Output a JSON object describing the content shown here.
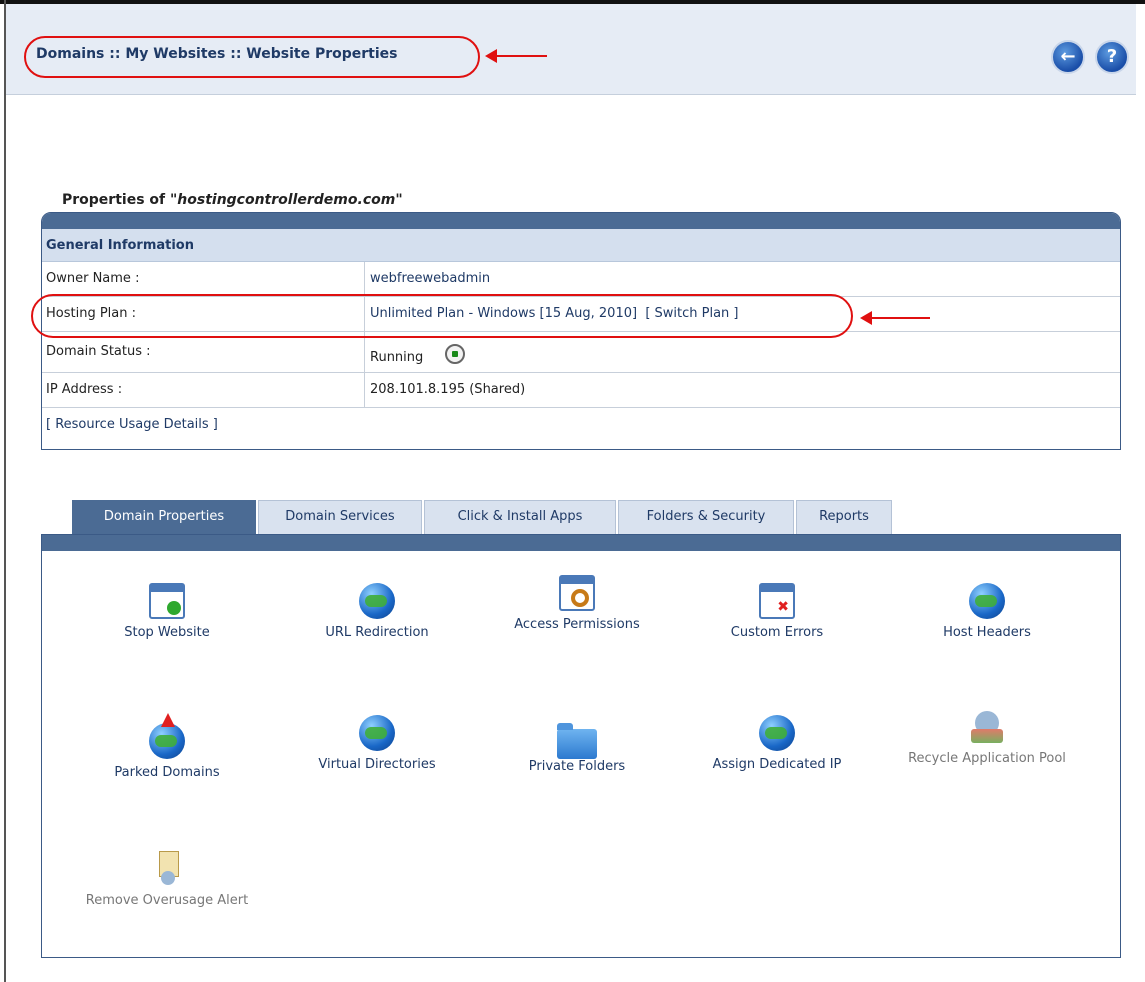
{
  "header": {
    "breadcrumb": "Domains :: My Websites :: Website Properties",
    "back_icon": "arrow-left-circle-icon",
    "help_icon": "question-circle-icon"
  },
  "properties": {
    "title_prefix": "Properties of ",
    "domain": "\"hostingcontrollerdemo.com\"",
    "section_label": "General Information",
    "rows": [
      {
        "label": "Owner Name :",
        "value": "webfreewebadmin"
      },
      {
        "label": "Hosting Plan :",
        "value": "Unlimited Plan - Windows [15 Aug, 2010]",
        "action": "[ Switch Plan ]"
      },
      {
        "label": "Domain Status :",
        "value": "Running"
      },
      {
        "label": "IP Address :",
        "value": "208.101.8.195 (Shared)"
      }
    ],
    "resource_link": "[ Resource Usage Details ]"
  },
  "tabs": [
    {
      "label": "Domain Properties",
      "active": true
    },
    {
      "label": "Domain Services"
    },
    {
      "label": "Click & Install Apps"
    },
    {
      "label": "Folders & Security"
    },
    {
      "label": "Reports"
    }
  ],
  "tools": [
    {
      "label": "Stop Website",
      "icon": "window-stop-icon"
    },
    {
      "label": "URL Redirection",
      "icon": "globe-redirect-icon"
    },
    {
      "label": "Access Permissions",
      "icon": "keys-icon"
    },
    {
      "label": "Custom Errors",
      "icon": "window-error-icon"
    },
    {
      "label": "Host Headers",
      "icon": "globe-window-icon"
    },
    {
      "label": "Parked Domains",
      "icon": "globe-arrow-icon"
    },
    {
      "label": "Virtual Directories",
      "icon": "globe-folder-icon"
    },
    {
      "label": "Private Folders",
      "icon": "folder-icon"
    },
    {
      "label": "Assign Dedicated IP",
      "icon": "globe-ip-icon"
    },
    {
      "label": "Recycle Application Pool",
      "icon": "recycle-icon",
      "disabled": true
    },
    {
      "label": "Remove Overusage Alert",
      "icon": "alert-document-icon",
      "disabled": true
    }
  ],
  "colors": {
    "accent": "#4b6b94",
    "annotation": "#e01010",
    "link": "#1f3a66"
  }
}
